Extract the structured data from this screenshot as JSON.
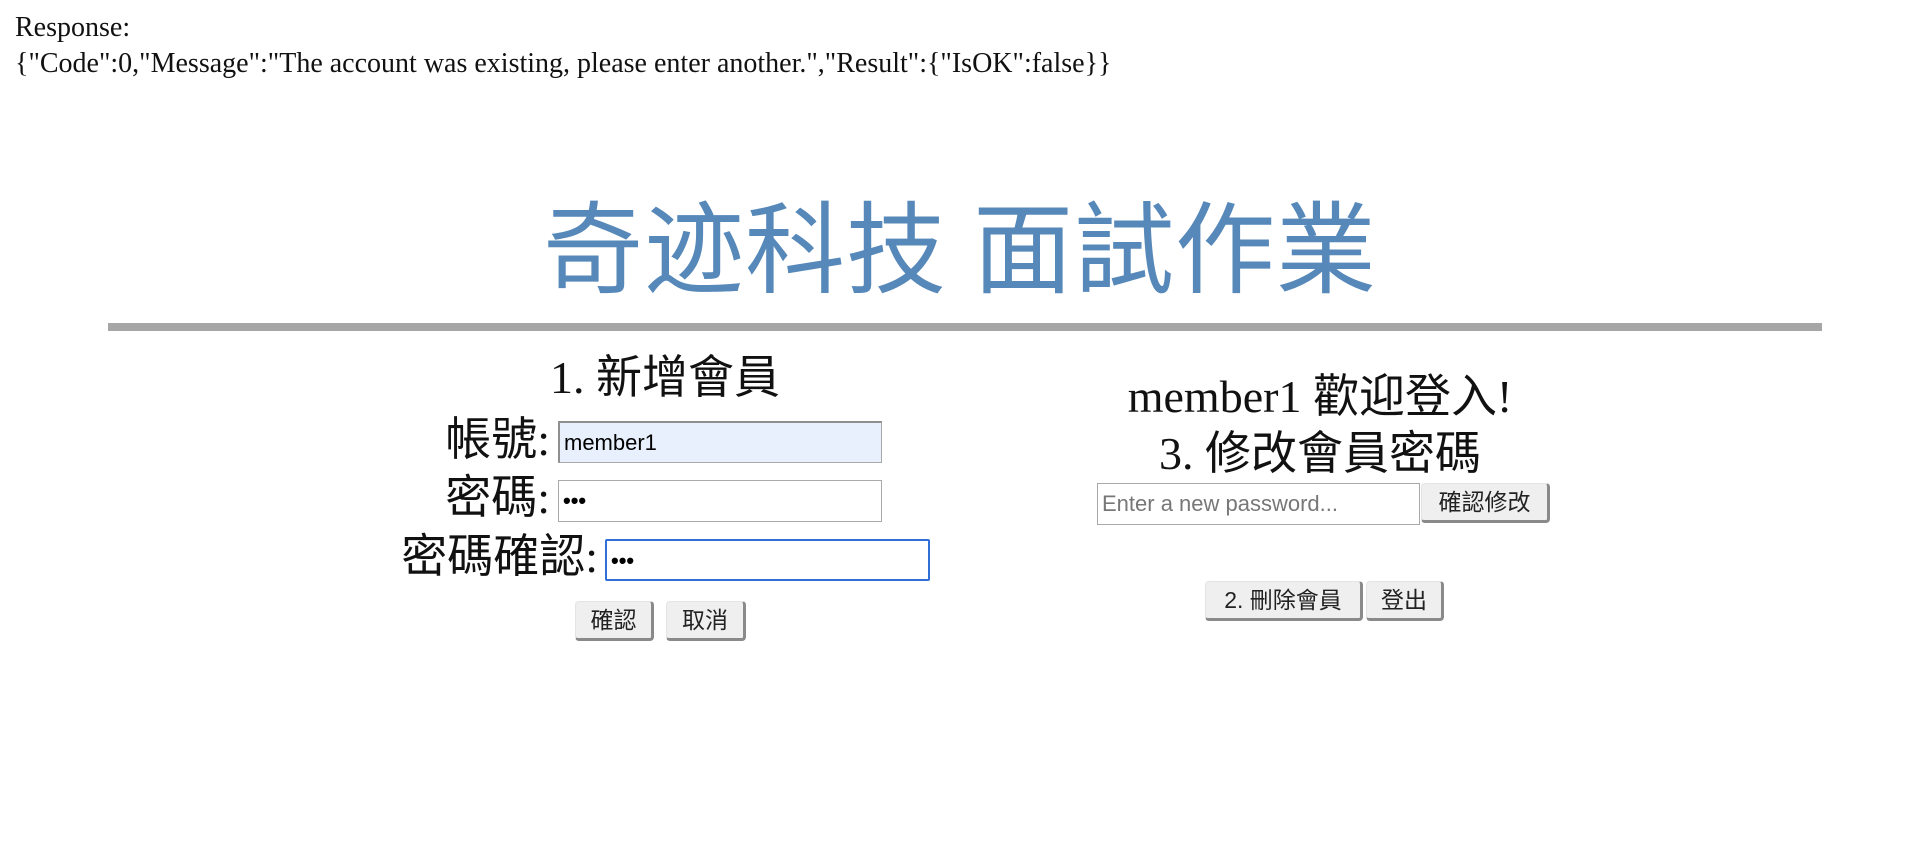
{
  "response": {
    "label": "Response:",
    "body": "{\"Code\":0,\"Message\":\"The account was existing, please enter another.\",\"Result\":{\"IsOK\":false}}"
  },
  "header": {
    "title": "奇迹科技 面試作業",
    "title_color": "#5688b9",
    "rule_color": "#a6a6a6"
  },
  "add_member": {
    "heading": "1. 新增會員",
    "account_label": "帳號:",
    "account_value": "member1",
    "password_label": "密碼:",
    "password_value": "•••",
    "confirm_label": "密碼確認:",
    "confirm_value": "•••",
    "confirm_button": "確認",
    "cancel_button": "取消"
  },
  "member_panel": {
    "welcome": "member1 歡迎登入!",
    "change_password_heading": "3. 修改會員密碼",
    "new_password_placeholder": "Enter a new password...",
    "confirm_change_button": "確認修改",
    "delete_member_button": "2. 刪除會員",
    "logout_button": "登出"
  }
}
